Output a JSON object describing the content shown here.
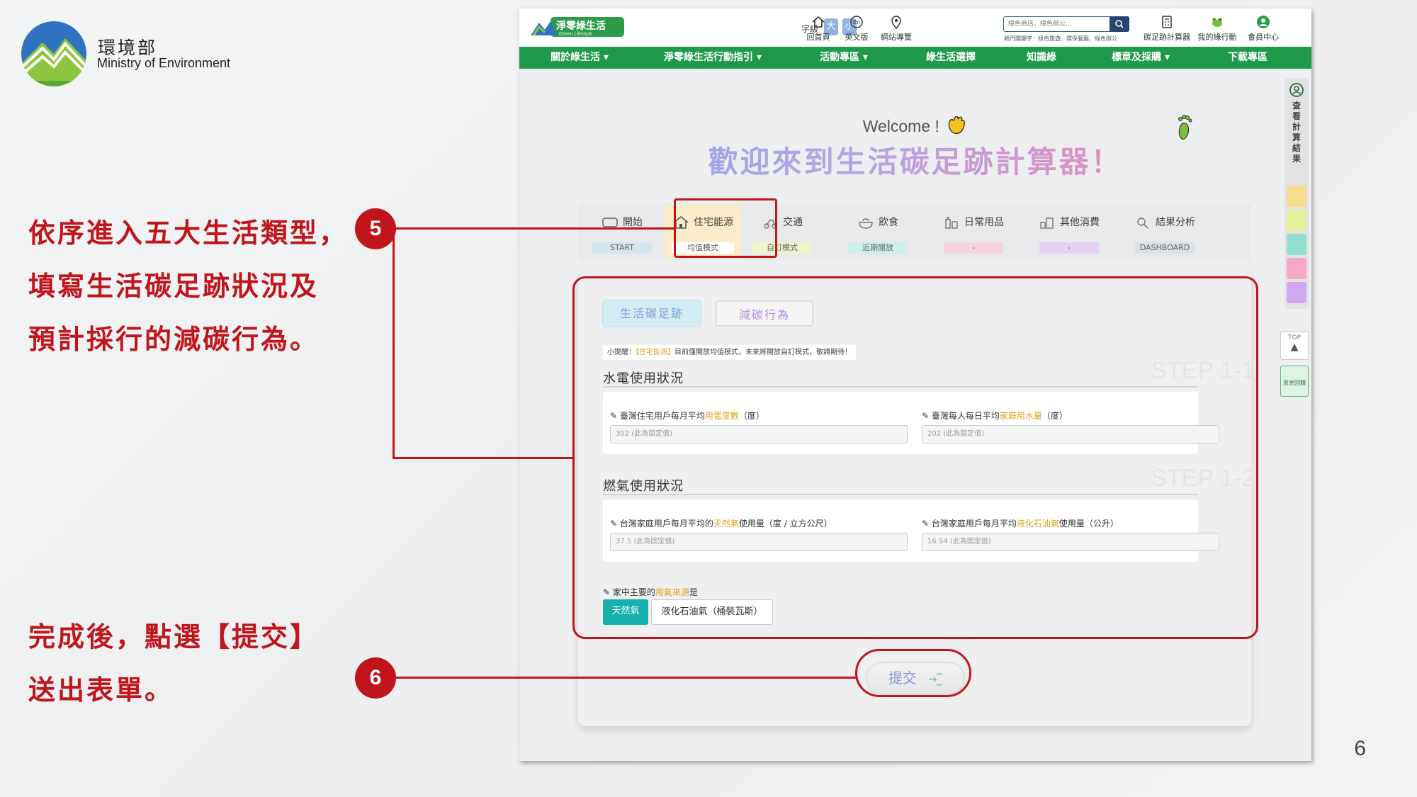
{
  "slide": {
    "org_zh": "環境部",
    "org_en": "Ministry of Environment",
    "note_a_lines": [
      "依序進入五大生活類型，",
      "填寫生活碳足跡狀況及",
      "預計採行的減碳行為。"
    ],
    "note_b_lines": [
      "完成後，點選【提交】",
      "送出表單。"
    ],
    "badge_5": "5",
    "badge_6": "6",
    "page_number": "6",
    "colors": {
      "accent_red": "#c0151d",
      "nav_green": "#1f9a4a"
    }
  },
  "site": {
    "logo_text": "淨零綠生活",
    "logo_sub": "Green Lifestyle",
    "font_size_label": "字級",
    "font_big": "大",
    "font_small": "小",
    "top_links": [
      {
        "label": "回首頁",
        "icon": "home-icon"
      },
      {
        "label": "英文版",
        "icon": "english-icon"
      },
      {
        "label": "網站導覽",
        "icon": "map-pin-icon"
      }
    ],
    "search_placeholder": "綠色商店、綠色辦公...",
    "search_hint": "熱門關鍵字：綠色旅遊、環保餐廳、綠色辦公",
    "right_links": [
      {
        "label": "碳足跡計算器",
        "icon": "calculator-icon"
      },
      {
        "label": "我的綠行動",
        "icon": "frog-icon"
      },
      {
        "label": "會員中心",
        "icon": "user-icon"
      }
    ],
    "nav": [
      "關於綠生活 ▾",
      "淨零綠生活行動指引 ▾",
      "活動專區 ▾",
      "綠生活選擇",
      "知識綠",
      "標章及採購 ▾",
      "下載專區"
    ]
  },
  "calculator": {
    "welcome": "Welcome !",
    "headline": "歡迎來到生活碳足跡計算器！",
    "tabs": [
      {
        "label": "開始",
        "sub": "START",
        "sub_color": "#d6e4ee"
      },
      {
        "label": "住宅能源",
        "sub": "均值模式",
        "sub_color": "#ffffff"
      },
      {
        "label": "交通",
        "sub": "自訂模式",
        "sub_color": "#eef4c9"
      },
      {
        "label": "飲食",
        "sub": "近期開放",
        "sub_color": "#cdefe9"
      },
      {
        "label": "日常用品",
        "sub": "-",
        "sub_color": "#f6d1e0"
      },
      {
        "label": "其他消費",
        "sub": "-",
        "sub_color": "#e3d2f3"
      },
      {
        "label": "結果分析",
        "sub": "DASHBOARD",
        "sub_color": "#d9e1e8"
      }
    ],
    "sub_tab_a": "生活碳足跡",
    "sub_tab_b": "減碳行為",
    "tip_prefix": "小提醒：",
    "tip_highlight": "【住宅能源】",
    "tip_suffix": "目前僅開放均值模式，未來將開放自訂模式，敬請期待！",
    "section1": {
      "title": "水電使用狀況",
      "step": "STEP 1-1",
      "f1_pre": "臺灣住宅用戶每月平均",
      "f1_hl": "用電度數",
      "f1_post": "（度）",
      "f1_value": "302 (此為固定值)",
      "f2_pre": "臺灣每人每日平均",
      "f2_hl": "家庭用水量",
      "f2_post": "（度）",
      "f2_value": "202 (此為固定值)"
    },
    "section2": {
      "title": "燃氣使用狀況",
      "step": "STEP 1-2",
      "f1_pre": "台灣家庭用戶每月平均的",
      "f1_hl": "天然氣",
      "f1_post": "使用量（度 / 立方公尺）",
      "f1_value": "37.5 (此為固定值)",
      "f2_pre": "台灣家庭用戶每月平均",
      "f2_hl": "液化石油氣",
      "f2_post": "使用量（公升）",
      "f2_value": "16.54 (此為固定值)"
    },
    "gas_question_pre": "家中主要的",
    "gas_question_hl": "用氣來源",
    "gas_question_post": "是",
    "gas_options": [
      "天然氣",
      "液化石油氣（桶裝瓦斯）"
    ],
    "submit": "提交"
  },
  "side": {
    "view_results": "查看計算結果",
    "top": "TOP",
    "qr": "意見回饋"
  }
}
